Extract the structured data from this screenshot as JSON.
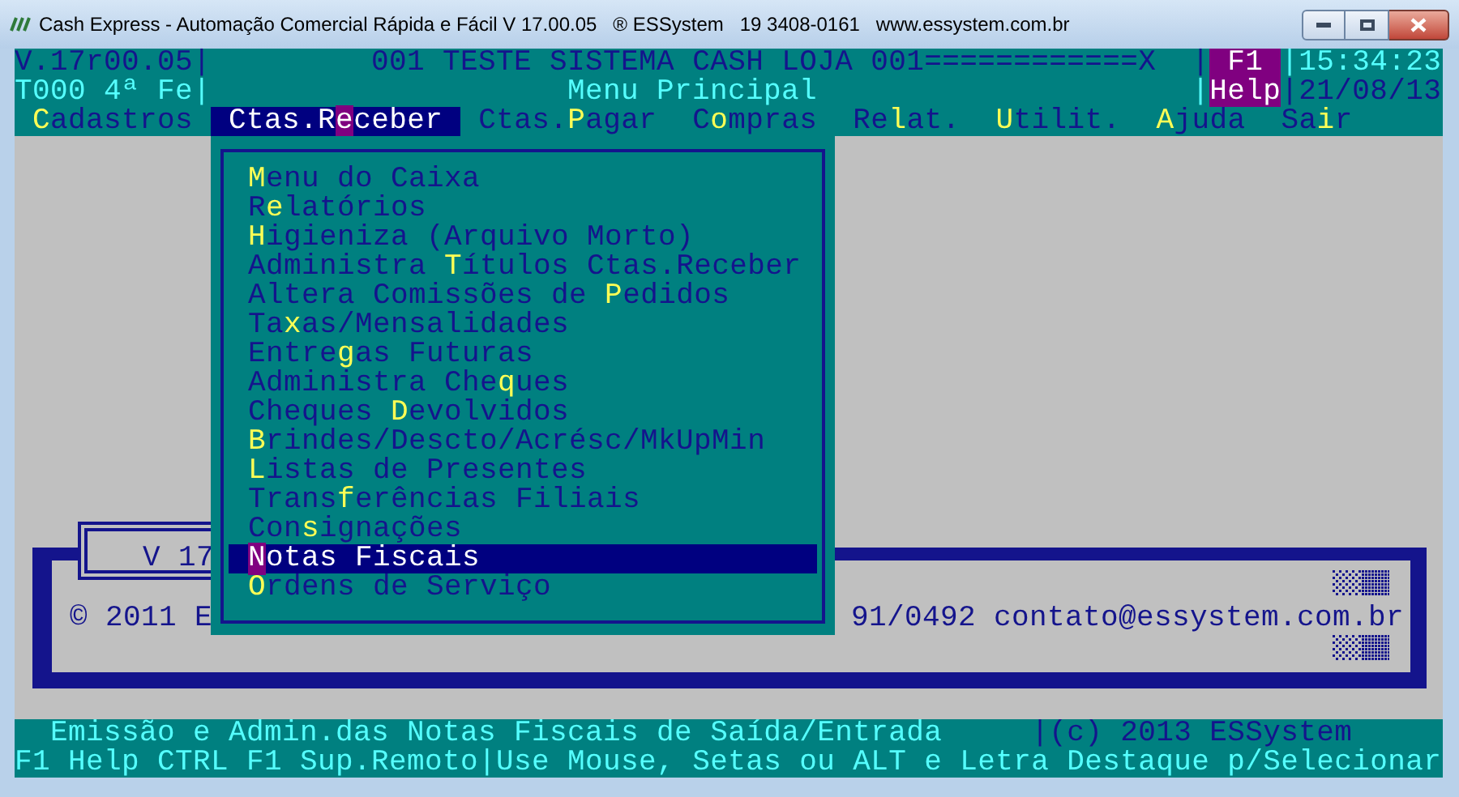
{
  "window": {
    "title": "Cash Express - Automação Comercial Rápida e Fácil V 17.00.05   ® ESSystem   19 3408-0161   www.essystem.com.br"
  },
  "header": {
    "version": "V.17r00.05|",
    "company": "001 TESTE SISTEMA CASH LOJA 001============X",
    "divider_1": "|",
    "help_key": "F1",
    "time": "|15:34:23",
    "day": "T000 4ª Fe|",
    "screen_title": "Menu Principal",
    "divider_2": "|",
    "help_label": "Help",
    "date": "|21/08/13"
  },
  "menu_bar": [
    {
      "label": "**C**adastros",
      "selected": false
    },
    {
      "label": "Ctas.R**e**ceber",
      "selected": true
    },
    {
      "label": "Ctas.**P**agar",
      "selected": false
    },
    {
      "label": "C**o**mpras",
      "selected": false
    },
    {
      "label": "Re**l**at.",
      "selected": false
    },
    {
      "label": "**U**tilit.",
      "selected": false
    },
    {
      "label": "**A**juda",
      "selected": false
    },
    {
      "label": "Sa**i**r",
      "selected": false
    }
  ],
  "dropdown": [
    {
      "label": "**M**enu do Caixa",
      "selected": false
    },
    {
      "label": "R**e**latórios",
      "selected": false
    },
    {
      "label": "**H**igieniza (Arquivo Morto)",
      "selected": false
    },
    {
      "label": "Administra **T**ítulos Ctas.Receber",
      "selected": false
    },
    {
      "label": "Altera Comissões de **P**edidos",
      "selected": false
    },
    {
      "label": "Ta**x**as/Mensalidades",
      "selected": false
    },
    {
      "label": "Entre**g**as Futuras",
      "selected": false
    },
    {
      "label": "Administra Che**q**ues",
      "selected": false
    },
    {
      "label": "Cheques **D**evolvidos",
      "selected": false
    },
    {
      "label": "**B**rindes/Descto/Acrésc/MkUpMin",
      "selected": false
    },
    {
      "label": "**L**istas de Presentes",
      "selected": false
    },
    {
      "label": "Trans**f**erências Filiais",
      "selected": false
    },
    {
      "label": "Con**s**ignações",
      "selected": false
    },
    {
      "label": "**N**otas Fiscais",
      "selected": true
    },
    {
      "label": "**O**rdens de Serviço",
      "selected": false
    }
  ],
  "splash": {
    "version": "V 17",
    "copyright": "© 2011 E",
    "contact": "91/0492 contato@essystem.com.br"
  },
  "status_bar": {
    "hint": "Emissão e Admin.das Notas Fiscais de Saída/Entrada",
    "copyright": "|(c) 2013 ESSystem",
    "keys": "F1 Help CTRL F1 Sup.Remoto|Use Mouse, Setas ou ALT e Letra Destaque p/Selecionar"
  }
}
